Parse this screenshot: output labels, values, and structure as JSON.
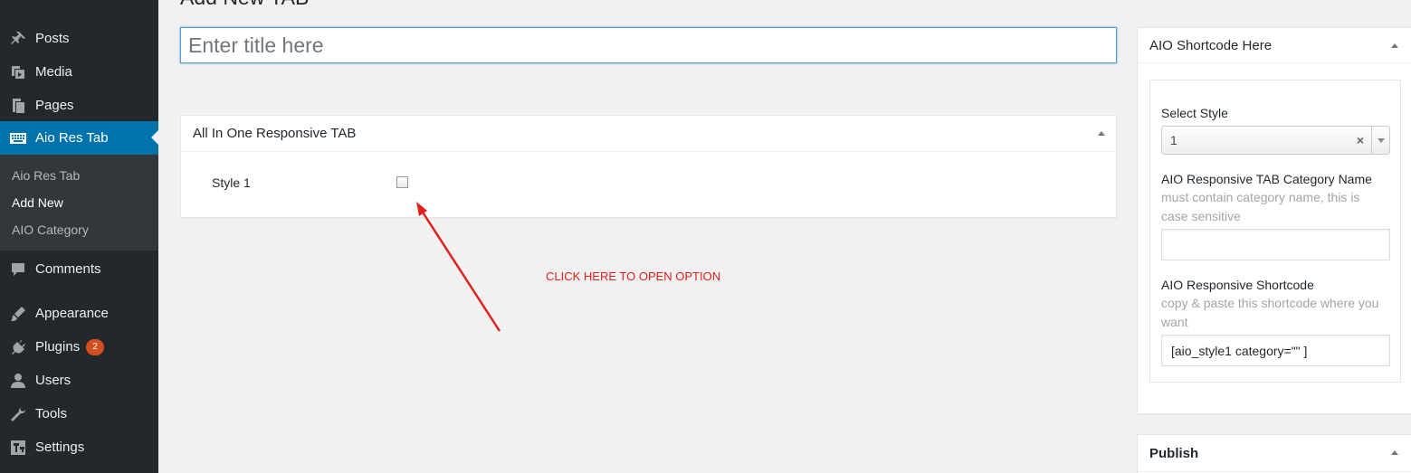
{
  "sidebar": {
    "items": [
      {
        "name": "posts",
        "label": "Posts",
        "icon": "pushpin-icon"
      },
      {
        "name": "media",
        "label": "Media",
        "icon": "media-icon"
      },
      {
        "name": "pages",
        "label": "Pages",
        "icon": "pages-icon"
      },
      {
        "name": "aio-res-tab",
        "label": "Aio Res Tab",
        "icon": "keyboard-icon"
      },
      {
        "name": "comments",
        "label": "Comments",
        "icon": "comment-icon"
      },
      {
        "name": "appearance",
        "label": "Appearance",
        "icon": "brush-icon"
      },
      {
        "name": "plugins",
        "label": "Plugins",
        "icon": "plugin-icon",
        "badge": "2"
      },
      {
        "name": "users",
        "label": "Users",
        "icon": "user-icon"
      },
      {
        "name": "tools",
        "label": "Tools",
        "icon": "wrench-icon"
      },
      {
        "name": "settings",
        "label": "Settings",
        "icon": "settings-icon"
      }
    ],
    "submenu": [
      {
        "label": "Aio Res Tab"
      },
      {
        "label": "Add New"
      },
      {
        "label": "AIO Category"
      }
    ],
    "active_color": "#0073aa",
    "background": "#23282d"
  },
  "main": {
    "heading": "Add New TAB",
    "title_placeholder": "Enter title here",
    "metabox": {
      "title": "All In One Responsive TAB",
      "style_label": "Style 1",
      "checked": false
    },
    "annotation": "CLICK HERE TO OPEN OPTION",
    "annotation_color": "#e0201b"
  },
  "shortcode_panel": {
    "title": "AIO Shortcode Here",
    "select_label": "Select Style",
    "select_value": "1",
    "select_clear": "×",
    "category_label": "AIO Responsive TAB Category Name",
    "category_desc": "must contain category name, this is case sensitive",
    "category_value": "",
    "shortcode_label": "AIO Responsive Shortcode",
    "shortcode_desc": "copy & paste this shortcode where you want",
    "shortcode_value": "[aio_style1 category=\"\" ]"
  },
  "publish_panel": {
    "title": "Publish"
  }
}
